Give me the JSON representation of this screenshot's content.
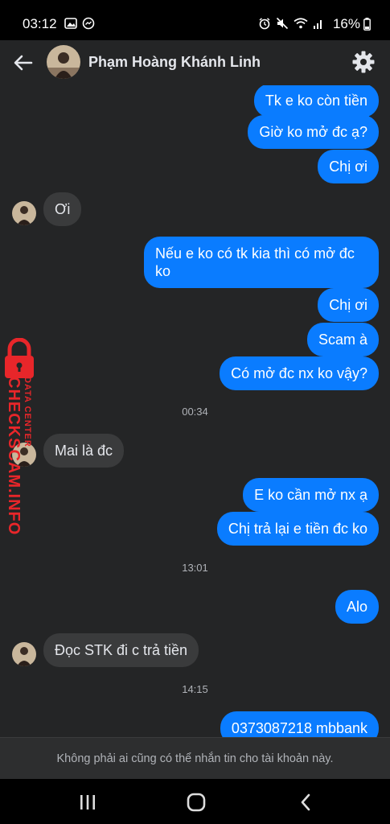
{
  "status_bar": {
    "time": "03:12",
    "battery": "16%"
  },
  "header": {
    "contact_name": "Phạm Hoàng Khánh Linh"
  },
  "messages": [
    {
      "dir": "out",
      "text": "Tk e ko còn tiền"
    },
    {
      "dir": "out",
      "text": "Giờ ko mở đc ạ?"
    },
    {
      "dir": "out",
      "text": "Chị ơi"
    },
    {
      "dir": "in",
      "text": "Ơi"
    },
    {
      "dir": "out",
      "text": "Nếu e ko có tk kia thì có mở đc",
      "text2": "ko"
    },
    {
      "dir": "out",
      "text": "Chị ơi"
    },
    {
      "dir": "out",
      "text": "Scam à"
    },
    {
      "dir": "out",
      "text": "Có mở đc nx ko vậy?"
    },
    {
      "dir": "in",
      "text": "Mai là đc"
    },
    {
      "dir": "out",
      "text": "E ko cần mở nx ạ"
    },
    {
      "dir": "out",
      "text": "Chị trả lại e tiền đc ko"
    },
    {
      "dir": "out",
      "text": "Alo"
    },
    {
      "dir": "in",
      "text": "Đọc STK đi c trả tiền"
    },
    {
      "dir": "out",
      "text": "0373087218 mbbank"
    }
  ],
  "timestamps": [
    "00:34",
    "13:01",
    "14:15"
  ],
  "footer": {
    "notice": "Không phải ai cũng có thể nhắn tin cho tài khoản này."
  },
  "watermark": {
    "line1": "DATA CENTER",
    "line2": "CHECKSCAM.INFO"
  },
  "colors": {
    "outgoing_bubble": "#0a7cff",
    "incoming_bubble": "#3a3b3c",
    "background": "#242526",
    "watermark": "#e8262a"
  }
}
